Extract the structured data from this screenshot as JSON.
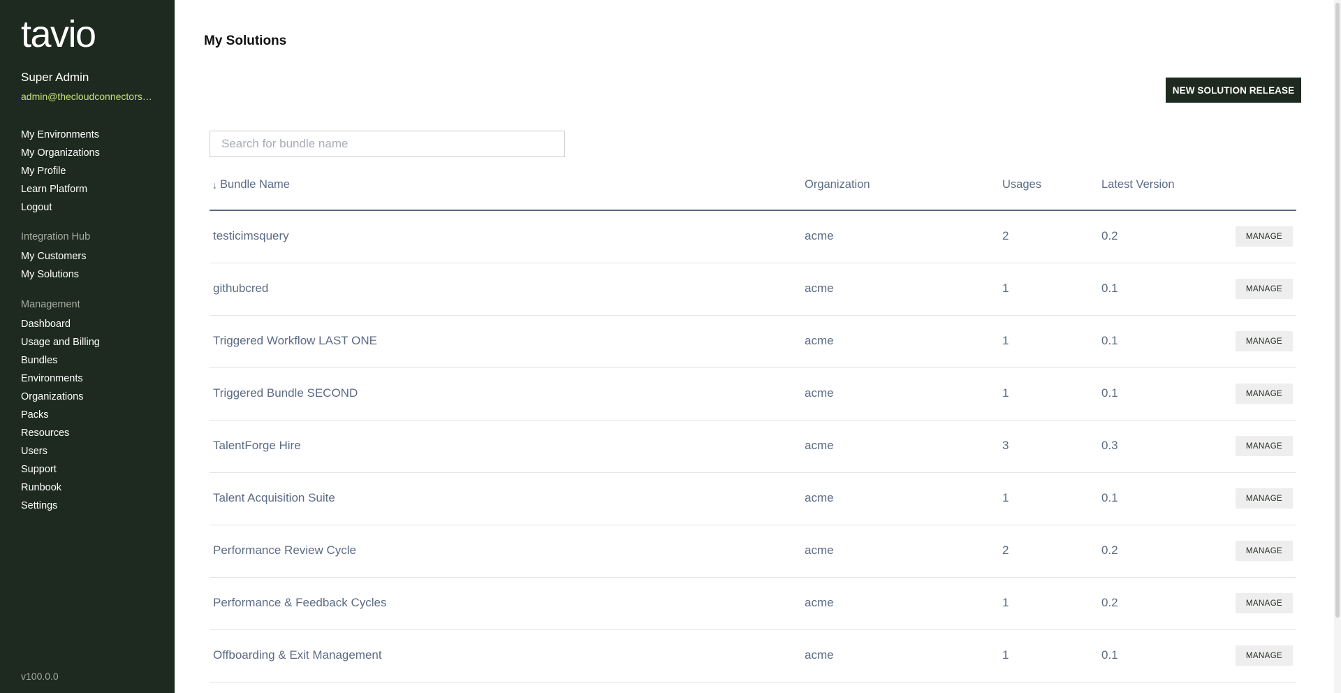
{
  "sidebar": {
    "logo": "tavio",
    "user": {
      "name": "Super Admin",
      "email": "admin@thecloudconnectors.com"
    },
    "top_links": [
      "My Environments",
      "My Organizations",
      "My Profile",
      "Learn Platform",
      "Logout"
    ],
    "integration_hub": {
      "heading": "Integration Hub",
      "links": [
        "My Customers",
        "My Solutions"
      ]
    },
    "management": {
      "heading": "Management",
      "links": [
        "Dashboard",
        "Usage and Billing",
        "Bundles",
        "Environments",
        "Organizations",
        "Packs",
        "Resources",
        "Users",
        "Support",
        "Runbook",
        "Settings"
      ]
    },
    "version": "v100.0.0"
  },
  "main": {
    "title": "My Solutions",
    "new_release_label": "NEW SOLUTION RELEASE",
    "search": {
      "placeholder": "Search for bundle name",
      "value": ""
    },
    "table": {
      "sort_icon": "arrow-down-icon",
      "headers": {
        "name": "Bundle Name",
        "organization": "Organization",
        "usages": "Usages",
        "version": "Latest Version"
      },
      "manage_label": "MANAGE",
      "rows": [
        {
          "name": "testicimsquery",
          "organization": "acme",
          "usages": "2",
          "version": "0.2"
        },
        {
          "name": "githubcred",
          "organization": "acme",
          "usages": "1",
          "version": "0.1"
        },
        {
          "name": "Triggered Workflow LAST ONE",
          "organization": "acme",
          "usages": "1",
          "version": "0.1"
        },
        {
          "name": "Triggered Bundle SECOND",
          "organization": "acme",
          "usages": "1",
          "version": "0.1"
        },
        {
          "name": "TalentForge Hire",
          "organization": "acme",
          "usages": "3",
          "version": "0.3"
        },
        {
          "name": "Talent Acquisition Suite",
          "organization": "acme",
          "usages": "1",
          "version": "0.1"
        },
        {
          "name": "Performance Review Cycle",
          "organization": "acme",
          "usages": "2",
          "version": "0.2"
        },
        {
          "name": "Performance & Feedback Cycles",
          "organization": "acme",
          "usages": "1",
          "version": "0.2"
        },
        {
          "name": "Offboarding & Exit Management",
          "organization": "acme",
          "usages": "1",
          "version": "0.1"
        }
      ]
    }
  },
  "colors": {
    "sidebar_bg": "#1e2a1f",
    "accent_email": "#c4e07a",
    "table_text": "#5c6b85"
  }
}
